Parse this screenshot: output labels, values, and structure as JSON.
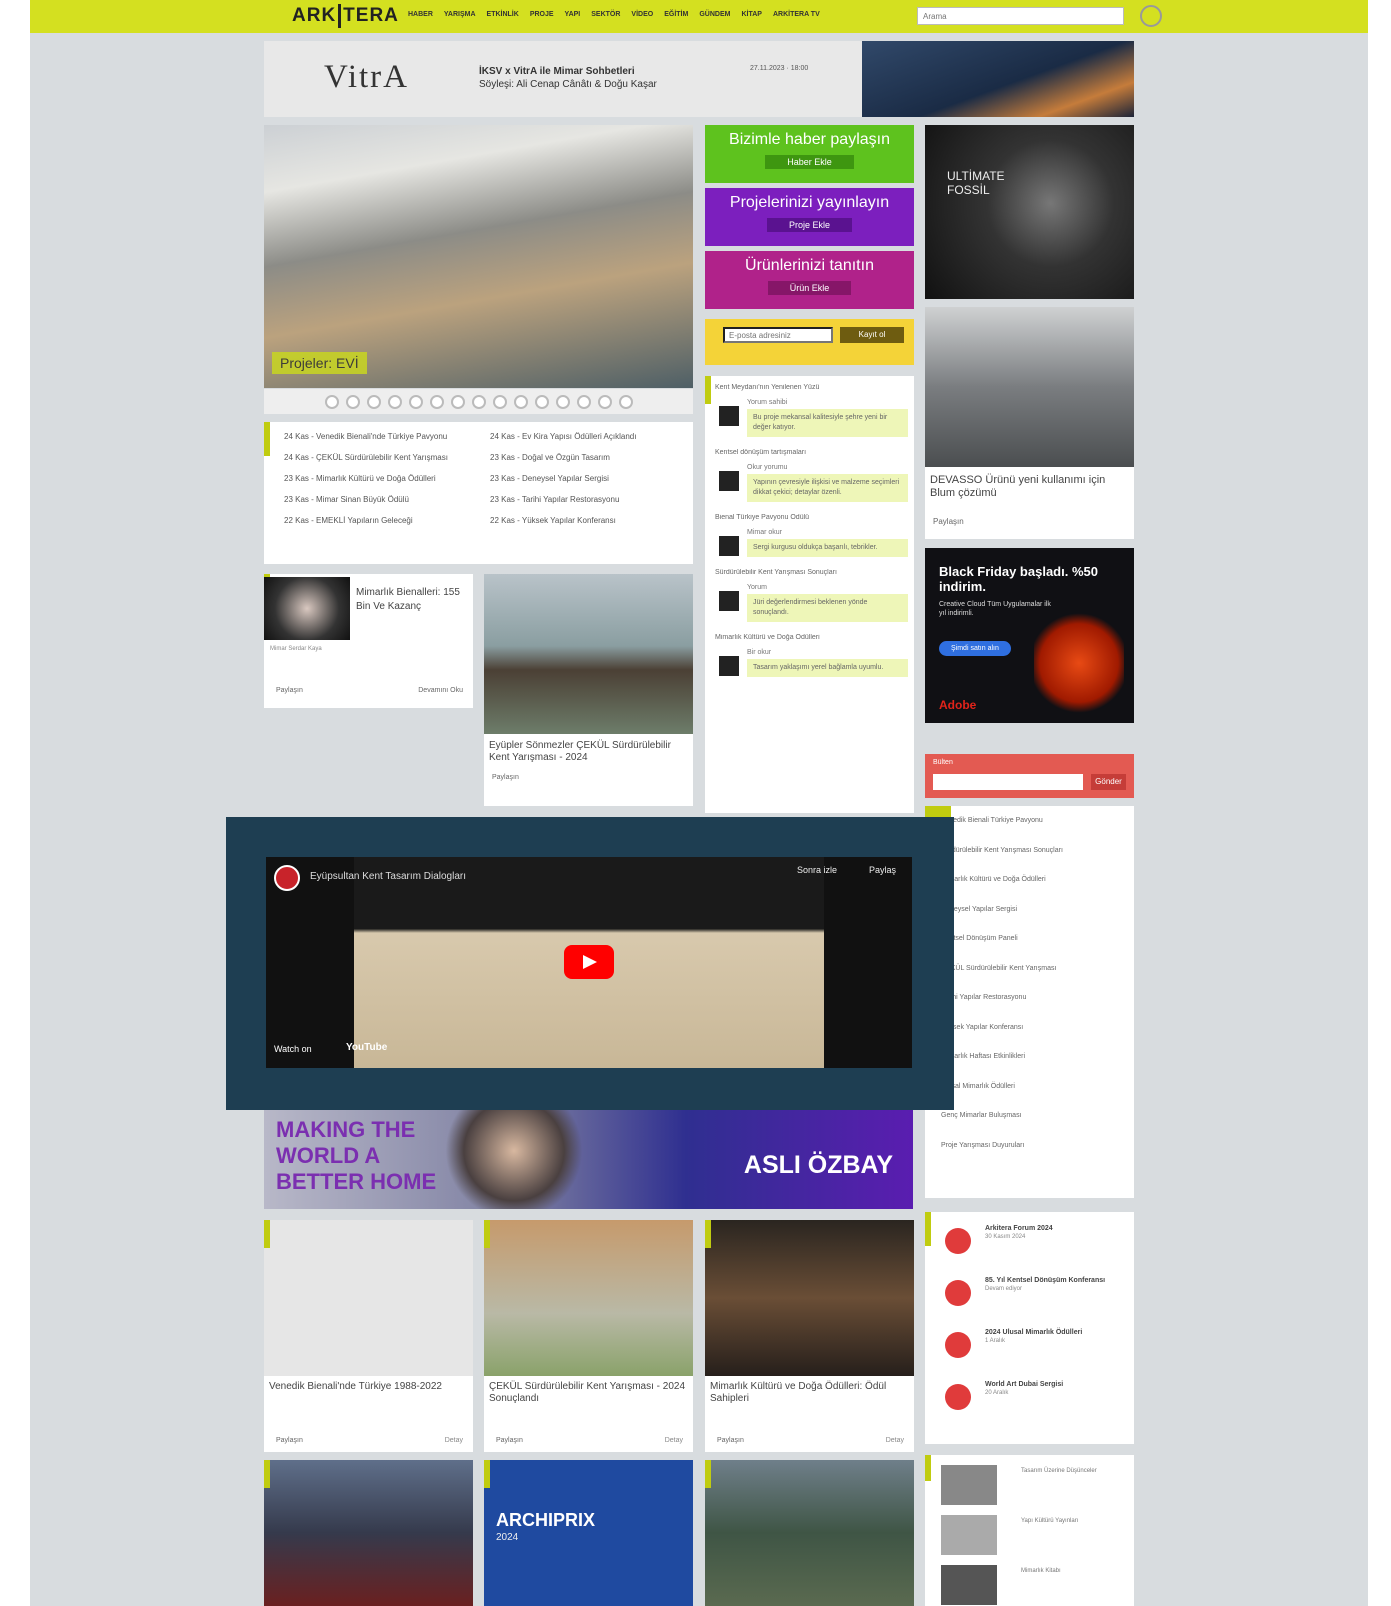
{
  "header": {
    "logo_a": "ARK",
    "logo_b": "TERA",
    "nav": [
      "HABER",
      "YARIŞMA",
      "ETKİNLİK",
      "PROJE",
      "YAPI",
      "SEKTÖR",
      "VİDEO",
      "EĞİTİM",
      "GÜNDEM",
      "KİTAP",
      "ARKİTERA TV"
    ],
    "search_placeholder": "Arama"
  },
  "top_ad": {
    "brand": "VitrA",
    "title": "İKSV x VitrA ile Mimar Sohbetleri",
    "subtitle": "Söyleşi: Ali Cenap Cânâtı & Doğu Kaşar",
    "info": "27.11.2023 · 18:00"
  },
  "slider": {
    "caption": "Projeler: EVİ",
    "colors": {
      "accent": "#c6d226"
    },
    "dot_count": 15
  },
  "news": [
    "24 Kas - Venedik Bienali'nde Türkiye Pavyonu",
    "24 Kas - Ev Kira Yapısı Ödülleri Açıklandı",
    "24 Kas - ÇEKÜL Sürdürülebilir Kent Yarışması",
    "23 Kas - Doğal ve Özgün Tasarım",
    "23 Kas - Mimarlık Kültürü ve Doğa Ödülleri",
    "23 Kas - Deneysel Yapılar Sergisi",
    "23 Kas - Mimar Sinan Büyük Ödülü",
    "23 Kas - Tarihi Yapılar Restorasyonu",
    "22 Kas - EMEKLİ Yapıların Geleceği",
    "22 Kas - Yüksek Yapılar Konferansı"
  ],
  "actions": [
    {
      "title": "Bizimle haber paylaşın",
      "button": "Haber Ekle",
      "color": "#5ec21e"
    },
    {
      "title": "Projelerinizi yayınlayın",
      "button": "Proje Ekle",
      "color": "#7c1fbe"
    },
    {
      "title": "Ürünlerinizi tanıtın",
      "button": "Ürün Ekle",
      "color": "#b0228a"
    }
  ],
  "subscribe": {
    "placeholder": "E-posta adresiniz",
    "button": "Kayıt ol"
  },
  "comments": [
    {
      "head": "Kent Meydanı'nın Yenilenen Yüzü",
      "user": "Yorum sahibi",
      "text": "Bu proje mekansal kalitesiyle şehre yeni bir değer katıyor."
    },
    {
      "head": "Kentsel dönüşüm tartışmaları",
      "user": "Okur yorumu",
      "text": "Yapının çevresiyle ilişkisi ve malzeme seçimleri dikkat çekici; detaylar özenli."
    },
    {
      "head": "Bienal Türkiye Pavyonu Ödülü",
      "user": "Mimar okur",
      "text": "Sergi kurgusu oldukça başarılı, tebrikler."
    },
    {
      "head": "Sürdürülebilir Kent Yarışması Sonuçları",
      "user": "Yorum",
      "text": "Jüri değerlendirmesi beklenen yönde sonuçlandı."
    },
    {
      "head": "Mimarlık Kültürü ve Doğa Ödülleri",
      "user": "Bir okur",
      "text": "Tasarım yaklaşımı yerel bağlamla uyumlu."
    }
  ],
  "ammonite_ad": {
    "title": "ULTİMATE FOSSİL"
  },
  "side_card": {
    "title": "DEVASSO Ürünü yeni kullanımı için Blum çözümü",
    "link": "Paylaşın"
  },
  "adobe": {
    "title": "Black Friday başladı. %50 indirim.",
    "text": "Creative Cloud Tüm Uygulamalar ilk yıl indirimli.",
    "button": "Şimdi satın alın",
    "logo": "Adobe"
  },
  "newsletter": {
    "label": "Bülten",
    "button": "Gönder"
  },
  "right_list": [
    "Venedik Bienali Türkiye Pavyonu",
    "Sürdürülebilir Kent Yarışması Sonuçları",
    "Mimarlık Kültürü ve Doğa Ödülleri",
    "Deneysel Yapılar Sergisi",
    "Kentsel Dönüşüm Paneli",
    "ÇEKÜL Sürdürülebilir Kent Yarışması",
    "Tarihi Yapılar Restorasyonu",
    "Yüksek Yapılar Konferansı",
    "Mimarlık Haftası Etkinlikleri",
    "Ulusal Mimarlık Ödülleri",
    "Genç Mimarlar Buluşması",
    "Proje Yarışması Duyuruları"
  ],
  "ksd": {
    "title": "Mimarlık Bienalleri: 155 Bin Ve Kazanç",
    "sub": "Mimar Serdar Kaya",
    "link1": "Paylaşın",
    "link2": "Devamını Oku"
  },
  "bridge": {
    "title": "Eyüpler Sönmezler ÇEKÜL Sürdürülebilir Kent Yarışması - 2024",
    "link": "Paylaşın"
  },
  "banner": {
    "left": "MAKING THE WORLD A BETTER HOME",
    "right": "ASLI ÖZBAY"
  },
  "video": {
    "title": "Eyüpsultan Kent Tasarım Dialogları",
    "watch_on": "Watch on",
    "yt": "YouTube",
    "share": "Paylaş",
    "watch_later": "Sonra izle"
  },
  "bottom_cards": [
    {
      "title": "Venedik Bienali'nde Türkiye 1988-2022",
      "l1": "Paylaşın",
      "l2": "Detay"
    },
    {
      "title": "ÇEKÜL Sürdürülebilir Kent Yarışması - 2024 Sonuçlandı",
      "l1": "Paylaşın",
      "l2": "Detay"
    },
    {
      "title": "Mimarlık Kültürü ve Doğa Ödülleri: Ödül Sahipleri",
      "l1": "Paylaşın",
      "l2": "Detay"
    }
  ],
  "events": [
    {
      "title": "Arkitera Forum 2024",
      "date": "30 Kasım 2024"
    },
    {
      "title": "85. Yıl Kentsel Dönüşüm Konferansı",
      "date": "Devam ediyor"
    },
    {
      "title": "2024 Ulusal Mimarlık Ödülleri",
      "date": "1 Aralık"
    },
    {
      "title": "World Art Dubai Sergisi",
      "date": "20 Aralık"
    }
  ],
  "books": [
    {
      "title": "Tasarım Üzerine Düşünceler"
    },
    {
      "title": "Yapı Kültürü Yayınları"
    },
    {
      "title": "Mimarlık Kitabı"
    }
  ],
  "archiprix": {
    "title": "ARCHIPRIX",
    "year": "2024"
  }
}
